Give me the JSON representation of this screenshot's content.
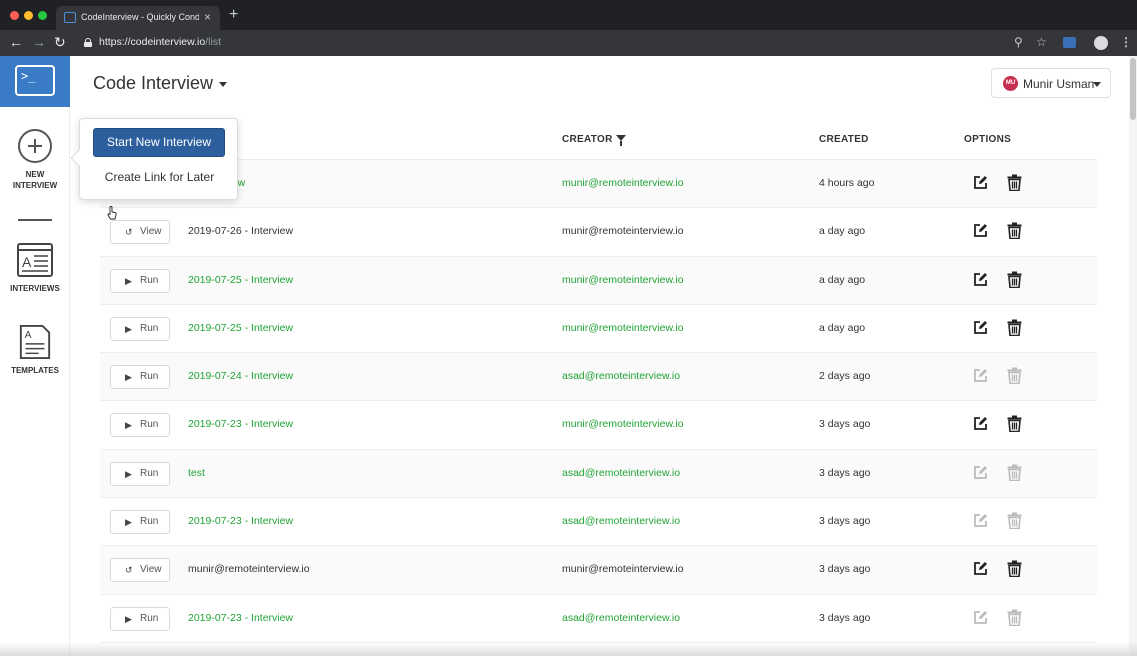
{
  "browser": {
    "tab_title": "CodeInterview - Quickly Cond",
    "tab_close": "×",
    "new_tab": "+",
    "url_host": "https://codeinterview.io",
    "url_path": "/list"
  },
  "header": {
    "title": "Code Interview",
    "user_initials": "MU",
    "user_name": "Munir Usman"
  },
  "sidebar": {
    "new_interview_line1": "NEW",
    "new_interview_line2": "INTERVIEW",
    "interviews": "INTERVIEWS",
    "templates": "TEMPLATES"
  },
  "popover": {
    "start_label": "Start New Interview",
    "later_label": "Create Link for Later"
  },
  "table": {
    "headers": {
      "creator": "CREATOR",
      "created": "CREATED",
      "options": "OPTIONS"
    },
    "rows": [
      {
        "action": "",
        "name": "6 - Interview",
        "name_style": "green",
        "creator": "munir@remoteinterview.io",
        "creator_style": "green",
        "created": "4 hours ago",
        "options_enabled": true
      },
      {
        "action": "View",
        "name": "2019-07-26 - Interview",
        "name_style": "dark",
        "creator": "munir@remoteinterview.io",
        "creator_style": "dark",
        "created": "a day ago",
        "options_enabled": true
      },
      {
        "action": "Run",
        "name": "2019-07-25 - Interview",
        "name_style": "green",
        "creator": "munir@remoteinterview.io",
        "creator_style": "green",
        "created": "a day ago",
        "options_enabled": true
      },
      {
        "action": "Run",
        "name": "2019-07-25 - Interview",
        "name_style": "green",
        "creator": "munir@remoteinterview.io",
        "creator_style": "green",
        "created": "a day ago",
        "options_enabled": true
      },
      {
        "action": "Run",
        "name": "2019-07-24 - Interview",
        "name_style": "green",
        "creator": "asad@remoteinterview.io",
        "creator_style": "green",
        "created": "2 days ago",
        "options_enabled": false
      },
      {
        "action": "Run",
        "name": "2019-07-23 - Interview",
        "name_style": "green",
        "creator": "munir@remoteinterview.io",
        "creator_style": "green",
        "created": "3 days ago",
        "options_enabled": true
      },
      {
        "action": "Run",
        "name": "test",
        "name_style": "green",
        "creator": "asad@remoteinterview.io",
        "creator_style": "green",
        "created": "3 days ago",
        "options_enabled": false
      },
      {
        "action": "Run",
        "name": "2019-07-23 - Interview",
        "name_style": "green",
        "creator": "asad@remoteinterview.io",
        "creator_style": "green",
        "created": "3 days ago",
        "options_enabled": false
      },
      {
        "action": "View",
        "name": "munir@remoteinterview.io",
        "name_style": "dark",
        "creator": "munir@remoteinterview.io",
        "creator_style": "dark",
        "created": "3 days ago",
        "options_enabled": true
      },
      {
        "action": "Run",
        "name": "2019-07-23 - Interview",
        "name_style": "green",
        "creator": "asad@remoteinterview.io",
        "creator_style": "green",
        "created": "3 days ago",
        "options_enabled": false
      }
    ]
  },
  "colors": {
    "brand_blue": "#3a7bc8",
    "primary_button": "#2d5f9e",
    "link_green": "#21a336",
    "avatar_red": "#c62f4f"
  }
}
